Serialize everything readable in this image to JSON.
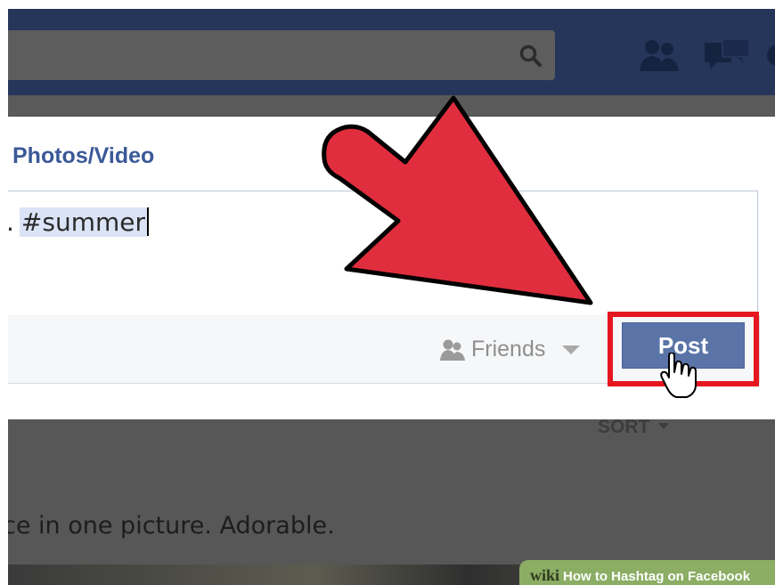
{
  "composer": {
    "tab_label": "Photos/Video",
    "text_prefix": ".",
    "hashtag": "#summer",
    "audience_label": "Friends",
    "post_label": "Post"
  },
  "feed": {
    "sort_label": "SORT",
    "post_text": "ce in one picture. Adorable."
  },
  "watermark": {
    "brand": "wiki",
    "title": "How to Hashtag on Facebook"
  },
  "colors": {
    "nav": "#26365a",
    "link": "#3b5998",
    "post_button": "#5b74a8",
    "highlight": "#e5161f",
    "arrow": "#e02e3e"
  },
  "icons": {
    "search": "search-icon",
    "friends": "friends-icon",
    "messages": "messages-icon",
    "audience": "friends-audience-icon",
    "cursor": "hand-cursor-icon",
    "arrow": "pointer-arrow"
  }
}
